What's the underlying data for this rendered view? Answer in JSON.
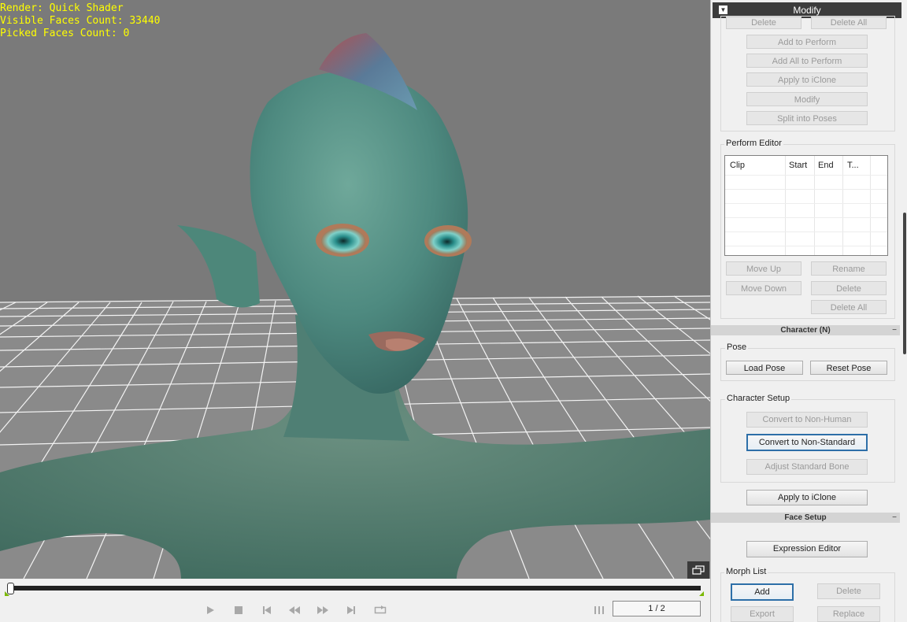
{
  "viewport": {
    "overlay_lines": [
      "Render: Quick Shader",
      "Visible Faces Count: 33440",
      "Picked Faces Count: 0"
    ]
  },
  "timeline": {
    "frame_display": "1 / 2",
    "track_color": "#202020",
    "marker_color": "#7ab800"
  },
  "panel": {
    "title": "Modify",
    "top_buttons": {
      "delete": "Delete",
      "delete_all": "Delete All",
      "add_to_perform": "Add to Perform",
      "add_all_to_perform": "Add All to Perform",
      "apply_to_iclone": "Apply to iClone",
      "modify": "Modify",
      "split_into_poses": "Split into Poses"
    },
    "perform_editor": {
      "label": "Perform Editor",
      "columns": [
        "Clip",
        "Start",
        "End",
        "T..."
      ],
      "move_up": "Move Up",
      "rename": "Rename",
      "move_down": "Move Down",
      "delete": "Delete",
      "delete_all": "Delete All"
    },
    "character_section": "Character (N)",
    "pose": {
      "label": "Pose",
      "load_pose": "Load Pose",
      "reset_pose": "Reset Pose"
    },
    "character_setup": {
      "label": "Character Setup",
      "convert_non_human": "Convert to Non-Human",
      "convert_non_standard": "Convert to Non-Standard",
      "adjust_standard_bone": "Adjust Standard Bone"
    },
    "apply_to_iclone": "Apply to iClone",
    "face_setup_section": "Face Setup",
    "expression_editor": "Expression Editor",
    "morph_list": {
      "label": "Morph List",
      "add": "Add",
      "delete": "Delete",
      "export": "Export",
      "replace": "Replace"
    },
    "collapse_glyph": "−",
    "dropdown_glyph": "▼"
  }
}
